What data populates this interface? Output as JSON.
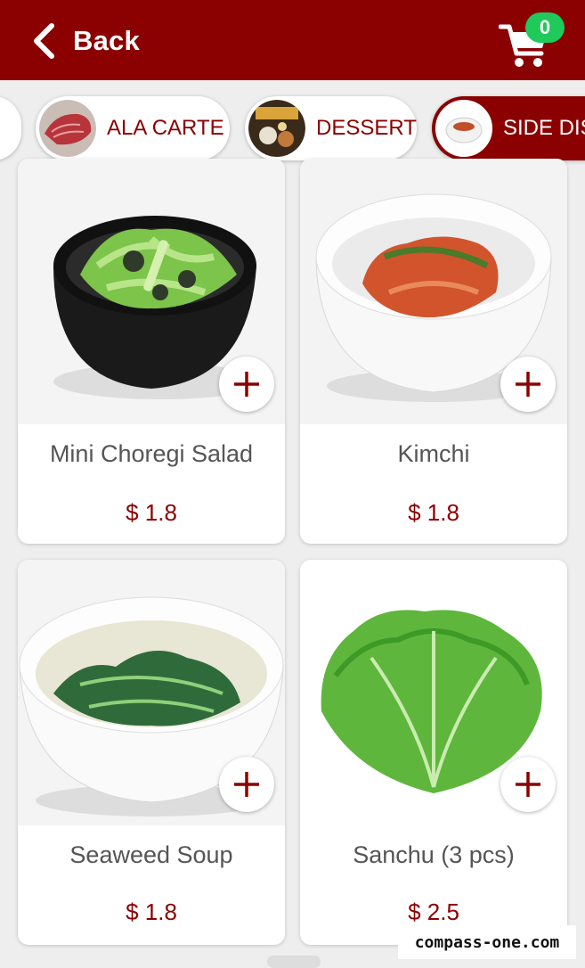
{
  "header": {
    "back_label": "Back",
    "cart_count": "0",
    "bar_color": "#8b0000",
    "badge_color": "#1fc95a",
    "icons": {
      "back": "chevron-left-icon",
      "cart": "shopping-cart-icon"
    }
  },
  "categories": [
    {
      "label": "",
      "active": false
    },
    {
      "label": "ALA CARTE",
      "active": false
    },
    {
      "label": "DESSERT",
      "active": false
    },
    {
      "label": "SIDE DISH",
      "active": true
    }
  ],
  "products": [
    {
      "name": "Mini Choregi Salad",
      "price": "$ 1.8"
    },
    {
      "name": "Kimchi",
      "price": "$ 1.8"
    },
    {
      "name": "Seaweed Soup",
      "price": "$ 1.8"
    },
    {
      "name": "Sanchu (3 pcs)",
      "price": "$ 2.5"
    }
  ],
  "watermark": "compass-one.com"
}
